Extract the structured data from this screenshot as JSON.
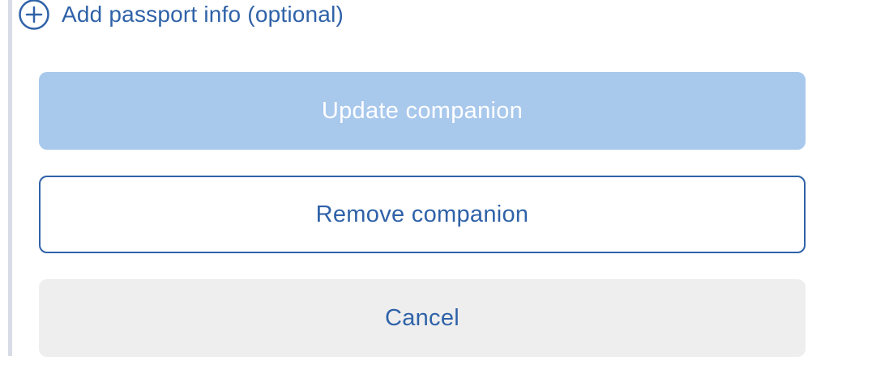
{
  "passport": {
    "label": "Add passport info (optional)",
    "icon": "plus-circle-icon"
  },
  "actions": {
    "update_label": "Update companion",
    "remove_label": "Remove companion",
    "cancel_label": "Cancel"
  },
  "colors": {
    "accent": "#2f62a8",
    "primary_disabled": "#a8c8ec",
    "secondary_bg": "#eeeeee",
    "rail": "#d7dce6"
  }
}
